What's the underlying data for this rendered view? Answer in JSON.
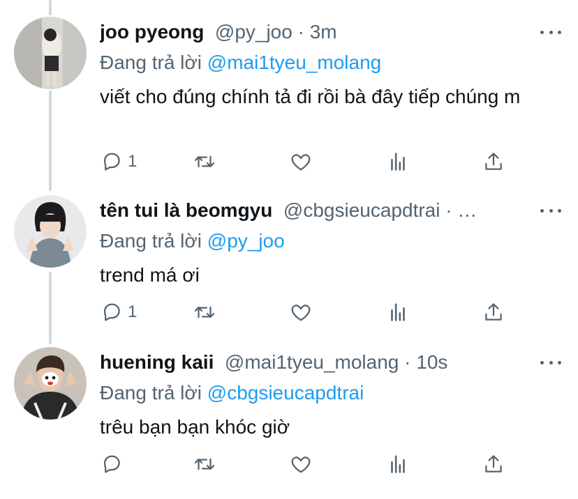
{
  "tweets": [
    {
      "display_name": "joo pyeong",
      "handle": "@py_joo",
      "separator": " · ",
      "time": "3m",
      "reply_prefix": "Đang trả lời ",
      "reply_to": "@mai1tyeu_molang",
      "text": "viết cho đúng chính tả đi rồi bà đây tiếp chúng m",
      "reply_count": "1",
      "retweet_count": "",
      "like_count": ""
    },
    {
      "display_name": "tên tui là beomgyu",
      "handle": "@cbgsieucapdtrai",
      "separator": " · ",
      "time": "…",
      "reply_prefix": "Đang trả lời ",
      "reply_to": "@py_joo",
      "text": "trend má ơi",
      "reply_count": "1",
      "retweet_count": "",
      "like_count": ""
    },
    {
      "display_name": "huening kaii",
      "handle": "@mai1tyeu_molang",
      "separator": " · ",
      "time": "10s",
      "reply_prefix": "Đang trả lời ",
      "reply_to": "@cbgsieucapdtrai",
      "text": "trêu bạn bạn khóc giờ",
      "reply_count": "",
      "retweet_count": "",
      "like_count": ""
    }
  ],
  "icons": {
    "reply": "reply-icon",
    "retweet": "retweet-icon",
    "like": "heart-icon",
    "views": "analytics-icon",
    "share": "share-icon",
    "more": "more-icon"
  },
  "colors": {
    "text": "#0f1419",
    "secondary": "#536471",
    "mention": "#1d9bf0",
    "thread_line": "#cfd9de"
  }
}
